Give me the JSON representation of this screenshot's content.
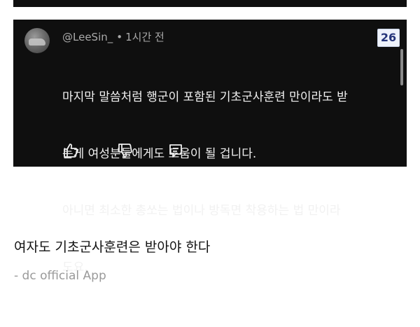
{
  "comment": {
    "username": "@LeeSin_",
    "separator": "•",
    "time_ago": "1시간 전",
    "lines": [
      "마지막 말씀처럼 행군이 포함된 기초군사훈련 만이라도 받",
      "는게 여성분들에게도 도움이 될 겁니다.",
      "아니면 최소한 총쏘는 법이나 방독면 착용하는 법 만이라",
      "도요."
    ],
    "like_count": "26",
    "icons": [
      "thumbs-up-icon",
      "thumbs-down-icon",
      "reply-icon"
    ]
  },
  "post": {
    "title": "여자도 기초군사훈련은 받아야 한다",
    "footer": "- dc official App"
  },
  "colors": {
    "card_background": "#0f0f0f",
    "comment_text": "#f1f1f1",
    "meta_text": "#aaaaaa",
    "badge_text": "#26357a",
    "page_background": "#ffffff"
  }
}
